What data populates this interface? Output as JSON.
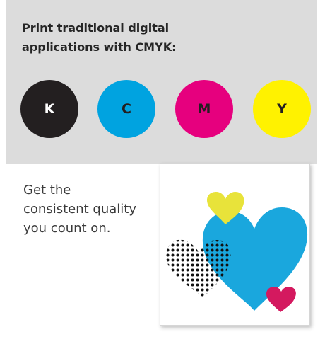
{
  "cmyk": {
    "heading": "Print traditional digital applications with CMYK:",
    "inks": [
      {
        "label": "K",
        "color": "#231f20",
        "text_color": "#ffffff"
      },
      {
        "label": "C",
        "color": "#00a3e0",
        "text_color": "#231f20"
      },
      {
        "label": "M",
        "color": "#e6007e",
        "text_color": "#231f20"
      },
      {
        "label": "Y",
        "color": "#fff200",
        "text_color": "#231f20"
      }
    ]
  },
  "promo": {
    "tagline": "Get the consistent quality you count on.",
    "photo_icon": "cmyk-hearts-print",
    "heart_colors": {
      "yellow": "#e8e33a",
      "cyan": "#1aa7dd",
      "magenta": "#d4195f",
      "black": "#111111"
    }
  }
}
